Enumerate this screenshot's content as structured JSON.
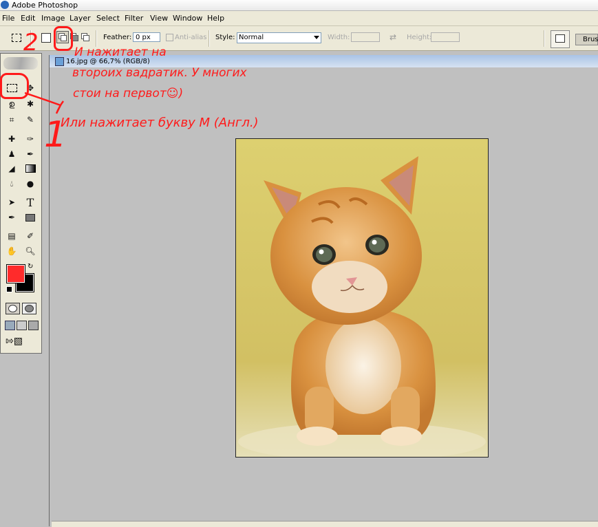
{
  "window": {
    "title": "Adobe Photoshop"
  },
  "menu": [
    "File",
    "Edit",
    "Image",
    "Layer",
    "Select",
    "Filter",
    "View",
    "Window",
    "Help"
  ],
  "options": {
    "feather_label": "Feather:",
    "feather_value": "0 px",
    "antialias_label": "Anti-alias",
    "style_label": "Style:",
    "style_value": "Normal",
    "width_label": "Width:",
    "height_label": "Height:",
    "brushes_tab": "Brush"
  },
  "document": {
    "title": "16.jpg @ 66,7% (RGB/8)"
  },
  "colors": {
    "foreground": "#ff2b2b",
    "background": "#000000",
    "annotation": "#ff1a1a"
  },
  "annotations": {
    "num1": "1",
    "num2": "2",
    "line2a": "И нажитает на",
    "line2b": "второих вадратик. У многих",
    "line2c": "стои на первот☺)",
    "line1": "Или нажитает букву М (Англ.)"
  },
  "icons": [
    "photoshop-logo-icon",
    "rectangular-marquee-icon",
    "move-icon",
    "lasso-icon",
    "magic-wand-icon",
    "crop-icon",
    "slice-icon",
    "healing-brush-icon",
    "brush-icon",
    "clone-stamp-icon",
    "history-brush-icon",
    "eraser-icon",
    "gradient-icon",
    "blur-icon",
    "dodge-icon",
    "path-selection-icon",
    "type-icon",
    "pen-icon",
    "shape-icon",
    "notes-icon",
    "eyedropper-icon",
    "hand-icon",
    "zoom-icon"
  ]
}
